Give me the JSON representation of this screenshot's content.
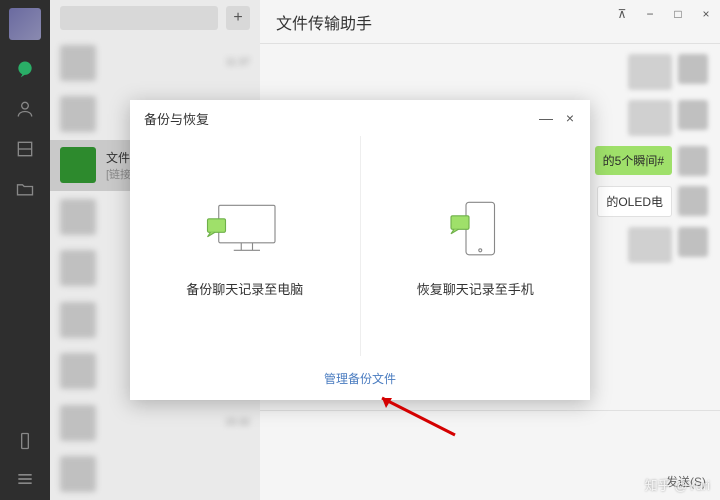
{
  "window": {
    "pin_icon": "pin",
    "min_icon": "−",
    "max_icon": "□",
    "close_icon": "×"
  },
  "nav": {
    "chat_icon": "chat",
    "contacts_icon": "contacts",
    "favorites_icon": "favorites",
    "files_icon": "files",
    "phone_icon": "phone",
    "menu_icon": "menu"
  },
  "convlist": {
    "add_label": "+",
    "items": [
      {
        "name": "",
        "time": "11:37"
      },
      {
        "name": "",
        "time": ""
      },
      {
        "name": "文件",
        "sub": "[链接]",
        "time": ""
      },
      {
        "name": "",
        "time": ""
      },
      {
        "name": "",
        "time": ""
      },
      {
        "name": "",
        "time": ""
      },
      {
        "name": "",
        "time": ""
      },
      {
        "name": "",
        "time": "15:32"
      },
      {
        "name": "",
        "time": ""
      }
    ]
  },
  "chat": {
    "title": "文件传输助手",
    "messages": [
      {
        "type": "image"
      },
      {
        "type": "bubble",
        "text": "的5个瞬间#"
      },
      {
        "type": "card",
        "text": "的OLED电"
      },
      {
        "type": "image"
      }
    ],
    "send_label": "发送(S)"
  },
  "modal": {
    "title": "备份与恢复",
    "min_label": "—",
    "close_label": "×",
    "backup_label": "备份聊天记录至电脑",
    "restore_label": "恢复聊天记录至手机",
    "manage_label": "管理备份文件"
  },
  "watermark": "知乎 @Yuri"
}
